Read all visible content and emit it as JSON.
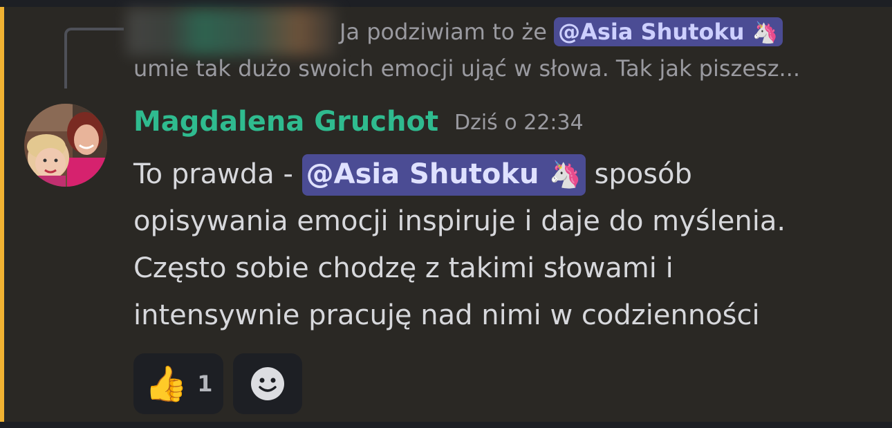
{
  "reply": {
    "text_before": "Ja podziwiam to że ",
    "mention": "@Asia Shutoku",
    "mention_emoji": "🦄",
    "text_line2": "umie tak dużo swoich emocji ująć w słowa. Tak jak piszesz..."
  },
  "message": {
    "author": "Magdalena Gruchot",
    "timestamp": "Dziś o 22:34",
    "line1_before": "To prawda - ",
    "mention": "@Asia Shutoku",
    "mention_emoji": "🦄",
    "line1_after": " sposób",
    "line2": "opisywania emocji inspiruje i daje do myślenia.",
    "line3": "Często sobie chodzę z takimi słowami i",
    "line4": "intensywnie pracuję nad nimi w codzienności"
  },
  "reactions": [
    {
      "emoji": "👍",
      "count": "1"
    }
  ],
  "colors": {
    "accent_bar": "#f0b232",
    "username": "#2fbb8f",
    "mention_bg": "#4b4c94",
    "background": "#2a2824"
  },
  "icons": {
    "add_reaction": "smiley-face-icon",
    "reply_spine": "reply-connector-icon"
  }
}
